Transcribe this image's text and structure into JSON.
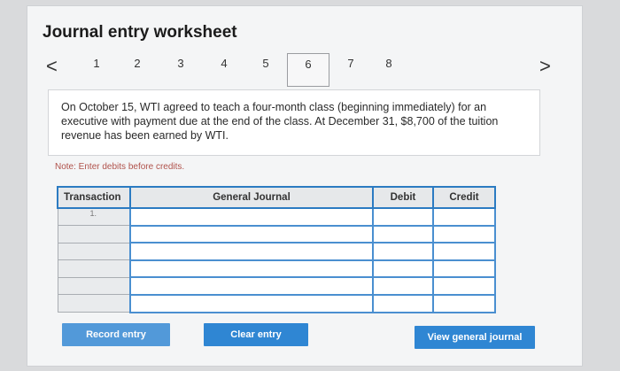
{
  "title": "Journal entry worksheet",
  "pager": {
    "prev_icon": "chevron-left-icon",
    "next_icon": "chevron-right-icon",
    "prev_glyph": "<",
    "next_glyph": ">",
    "pages": [
      "1",
      "2",
      "3",
      "4",
      "5",
      "6",
      "7",
      "8"
    ],
    "active_page": "6"
  },
  "prompt": "On October 15, WTI agreed to teach a four-month class (beginning immediately) for an executive with payment due at the end of the class. At December 31, $8,700 of the tuition revenue has been earned by WTI.",
  "note": "Note: Enter debits before credits.",
  "table": {
    "headers": {
      "transaction": "Transaction",
      "general_journal": "General Journal",
      "debit": "Debit",
      "credit": "Credit"
    },
    "rows": [
      {
        "transaction": "1.",
        "general_journal": "",
        "debit": "",
        "credit": ""
      },
      {
        "transaction": "",
        "general_journal": "",
        "debit": "",
        "credit": ""
      },
      {
        "transaction": "",
        "general_journal": "",
        "debit": "",
        "credit": ""
      },
      {
        "transaction": "",
        "general_journal": "",
        "debit": "",
        "credit": ""
      },
      {
        "transaction": "",
        "general_journal": "",
        "debit": "",
        "credit": ""
      },
      {
        "transaction": "",
        "general_journal": "",
        "debit": "",
        "credit": ""
      }
    ]
  },
  "buttons": {
    "record": "Record entry",
    "clear": "Clear entry",
    "view": "View general journal"
  },
  "colors": {
    "accent": "#2f86d3",
    "note": "#b0524b"
  }
}
